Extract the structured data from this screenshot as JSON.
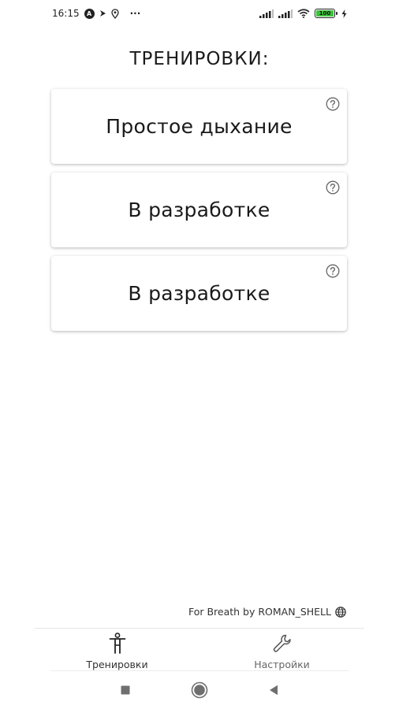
{
  "status_bar": {
    "time": "16:15",
    "notification_badge": "A",
    "more": "···",
    "battery_level": "100",
    "icons": [
      "badge-a-icon",
      "navigation-icon",
      "location-pin-icon",
      "more-dots-icon",
      "signal-icon",
      "signal-icon",
      "wifi-icon",
      "battery-icon",
      "charging-bolt-icon"
    ]
  },
  "page": {
    "title": "ТРЕНИРОВКИ:"
  },
  "cards": [
    {
      "label": "Простое дыхание",
      "icon": "help-circle-icon"
    },
    {
      "label": "В разработке",
      "icon": "help-circle-icon"
    },
    {
      "label": "В разработке",
      "icon": "help-circle-icon"
    }
  ],
  "credit": {
    "text": "For Breath by ROMAN_SHELL",
    "icon": "globe-icon"
  },
  "bottom_nav": {
    "items": [
      {
        "label": "Тренировки",
        "icon": "person-figure-icon",
        "active": true
      },
      {
        "label": "Настройки",
        "icon": "wrench-icon",
        "active": false
      }
    ]
  },
  "system_nav": {
    "icons": [
      "square-recents-icon",
      "circle-home-icon",
      "triangle-back-icon"
    ]
  },
  "colors": {
    "battery_fill": "#3cc23c",
    "text": "#1a1a1a",
    "background": "#ffffff"
  }
}
